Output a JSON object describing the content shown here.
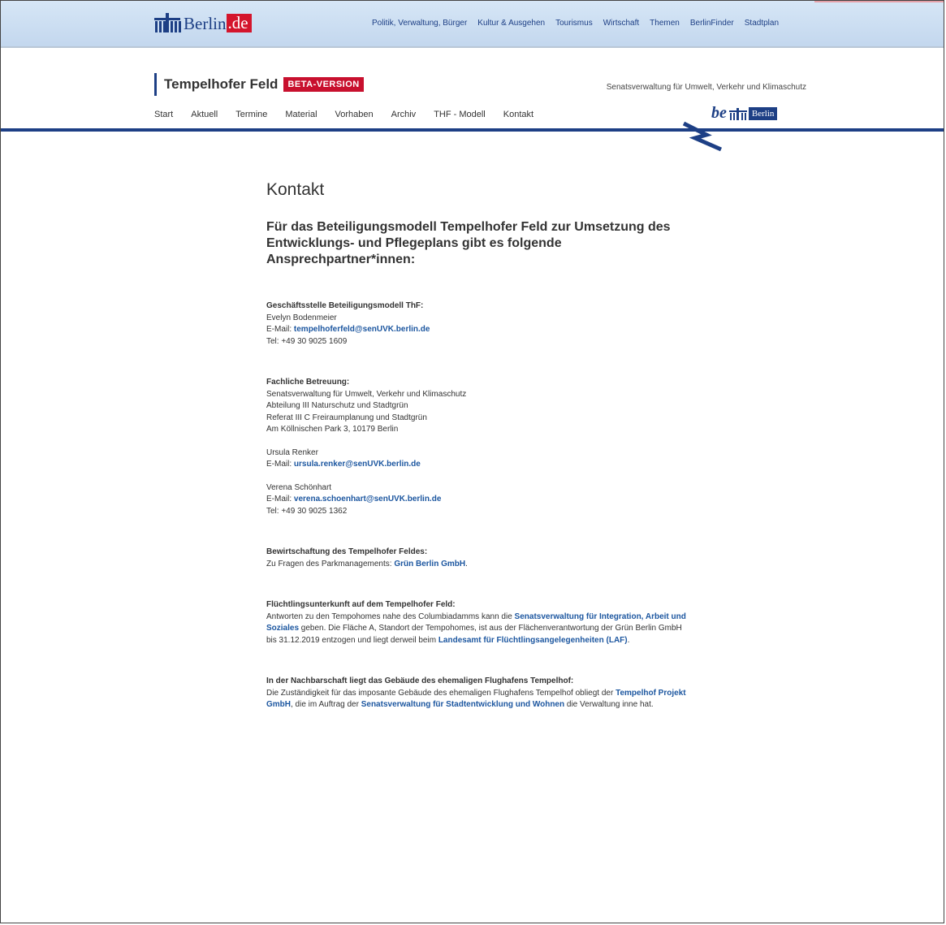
{
  "header": {
    "logo_word": "Berlin",
    "logo_tld": ".de",
    "top_nav": [
      "Politik, Verwaltung, Bürger",
      "Kultur & Ausgehen",
      "Tourismus",
      "Wirtschaft",
      "Themen",
      "BerlinFinder",
      "Stadtplan"
    ]
  },
  "site": {
    "title": "Tempelhofer Feld",
    "badge": "BETA-VERSION",
    "senat": "Senatsverwaltung für Umwelt, Verkehr und Klimaschutz",
    "be_text": "be",
    "berlin_label": "Berlin",
    "main_nav": [
      "Start",
      "Aktuell",
      "Termine",
      "Material",
      "Vorhaben",
      "Archiv",
      "THF - Modell",
      "Kontakt"
    ]
  },
  "content": {
    "title": "Kontakt",
    "lead": "Für das Beteiligungsmodell Tempelhofer Feld zur Umsetzung des Entwicklungs- und Pflegeplans gibt es folgende Ansprechpartner*innen:",
    "geschaeft": {
      "heading": "Geschäftsstelle Beteiligungsmodell ThF:",
      "name": "Evelyn Bodenmeier",
      "email_label": "E-Mail: ",
      "email": "tempelhoferfeld@senUVK.berlin.de",
      "tel": "Tel: +49 30 9025 1609"
    },
    "fachlich": {
      "heading": "Fachliche Betreuung:",
      "line1": "Senatsverwaltung für Umwelt, Verkehr und Klimaschutz",
      "line2": "Abteilung III Naturschutz und Stadtgrün",
      "line3": "Referat III C Freiraumplanung und Stadtgrün",
      "line4": "Am Köllnischen Park 3, 10179 Berlin",
      "p1_name": "Ursula Renker",
      "p1_email_label": "E-Mail: ",
      "p1_email": "ursula.renker@senUVK.berlin.de",
      "p2_name": "Verena Schönhart",
      "p2_email_label": "E-Mail: ",
      "p2_email": "verena.schoenhart@senUVK.berlin.de",
      "p2_tel": "Tel: +49 30 9025 1362"
    },
    "bewirt": {
      "heading": "Bewirtschaftung des Tempelhofer Feldes:",
      "text": "Zu Fragen des Parkmanagements: ",
      "link": "Grün Berlin GmbH",
      "end": "."
    },
    "fluecht": {
      "heading": "Flüchtlingsunterkunft auf dem Tempelhofer Feld:",
      "t1": "Antworten zu den Tempohomes nahe des Columbiadamms kann die ",
      "link1": "Senatsverwaltung für Integration, Arbeit und Soziales",
      "t2": " geben. Die Fläche A, Standort der Tempohomes, ist aus der Flächenverantwortung der Grün Berlin GmbH  bis 31.12.2019 entzogen und liegt derweil beim ",
      "link2": "Landesamt für Flüchtlingsangelegenheiten (LAF)",
      "t3": "."
    },
    "nachbar": {
      "heading": "In der Nachbarschaft liegt das Gebäude des ehemaligen Flughafens Tempelhof:",
      "t1": "Die Zuständigkeit für das imposante Gebäude des ehemaligen Flughafens Tempelhof obliegt der ",
      "link1": "Tempelhof Projekt GmbH",
      "t2": ", die im Auftrag der ",
      "link2": "Senatsverwaltung für Stadtentwicklung und Wohnen",
      "t3": " die Verwaltung inne hat."
    }
  }
}
